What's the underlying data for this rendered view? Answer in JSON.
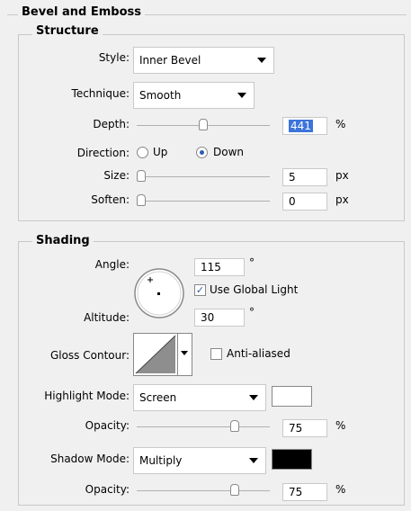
{
  "panel": {
    "title": "Bevel and Emboss",
    "structure": {
      "title": "Structure",
      "style": {
        "label": "Style:",
        "value": "Inner Bevel"
      },
      "technique": {
        "label": "Technique:",
        "value": "Smooth"
      },
      "depth": {
        "label": "Depth:",
        "value": "441",
        "unit": "%",
        "slider_fraction": 0.5
      },
      "direction": {
        "label": "Direction:",
        "options": [
          "Up",
          "Down"
        ],
        "selected": "Down"
      },
      "size": {
        "label": "Size:",
        "value": "5",
        "unit": "px",
        "slider_fraction": 0.0
      },
      "soften": {
        "label": "Soften:",
        "value": "0",
        "unit": "px",
        "slider_fraction": 0.0
      }
    },
    "shading": {
      "title": "Shading",
      "angle": {
        "label": "Angle:",
        "value": "115",
        "unit": "°"
      },
      "global_light": {
        "label": "Use Global Light",
        "checked": true
      },
      "altitude": {
        "label": "Altitude:",
        "value": "30",
        "unit": "°"
      },
      "gloss_contour": {
        "label": "Gloss Contour:"
      },
      "anti_aliased": {
        "label": "Anti-aliased",
        "checked": false
      },
      "highlight_mode": {
        "label": "Highlight Mode:",
        "value": "Screen",
        "color": "#ffffff"
      },
      "highlight_opacity": {
        "label": "Opacity:",
        "value": "75",
        "unit": "%",
        "slider_fraction": 0.75
      },
      "shadow_mode": {
        "label": "Shadow Mode:",
        "value": "Multiply",
        "color": "#000000"
      },
      "shadow_opacity": {
        "label": "Opacity:",
        "value": "75",
        "unit": "%",
        "slider_fraction": 0.75
      }
    }
  }
}
